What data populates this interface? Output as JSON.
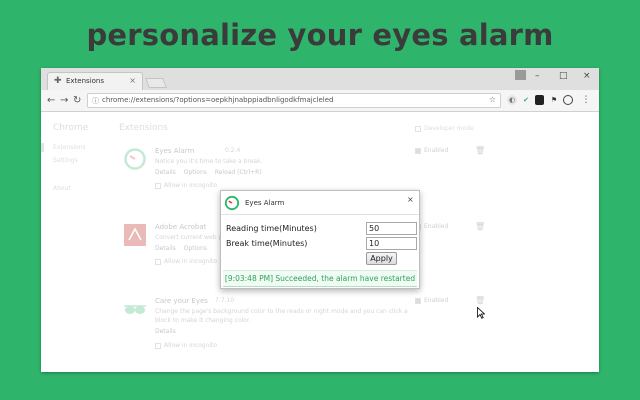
{
  "headline": "personalize your eyes alarm",
  "browser": {
    "tab_title": "Extensions",
    "tab_close": "×",
    "url": "chrome://extensions/?options=oepkhjnabppiadbnligodkfmajcleled",
    "window_controls": {
      "minimize": "–",
      "maximize": "□",
      "close": "×"
    }
  },
  "sidebar": {
    "title": "Chrome",
    "items": [
      "Extensions",
      "Settings",
      "About"
    ]
  },
  "main": {
    "title": "Extensions",
    "developer_mode": "Developer mode",
    "extensions": [
      {
        "name": "Eyes Alarm",
        "version": "0.2.4",
        "description": "Notice you it's time to take a break.",
        "links": [
          "Details",
          "Options",
          "Reload (Ctrl+R)"
        ],
        "incognito": "Allow in incognito",
        "enabled": "Enabled"
      },
      {
        "name": "Adobe Acrobat",
        "version": "",
        "description": "Convert current web p",
        "links": [
          "Details",
          "Options"
        ],
        "incognito": "Allow in incognito",
        "enabled": "Enabled"
      },
      {
        "name": "Care your Eyes",
        "version": "7.7.10",
        "description": "Change the page's background color to the reads or night mode and you can click a",
        "description2": "block to make it changing color.",
        "links": [
          "Details"
        ],
        "incognito": "Allow in incognito",
        "enabled": "Enabled"
      }
    ]
  },
  "dialog": {
    "title": "Eyes Alarm",
    "close": "×",
    "reading_label": "Reading time(Minutes)",
    "reading_value": "50",
    "break_label": "Break time(Minutes)",
    "break_value": "10",
    "apply_label": "Apply",
    "status": "[9:03:48 PM] Succeeded, the alarm have restarted"
  },
  "colors": {
    "background": "#2fb56b",
    "headline": "#3b3b3b",
    "status_text": "#2fa35f",
    "alarm_ring": "#2fb56b",
    "alarm_hand": "#e53935"
  },
  "icons": [
    "puzzle-icon",
    "back-icon",
    "forward-icon",
    "reload-icon",
    "info-icon",
    "star-icon",
    "trash-icon",
    "cursor-icon"
  ]
}
